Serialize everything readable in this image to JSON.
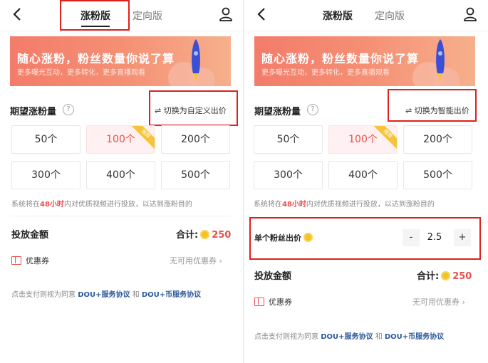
{
  "colors": {
    "accent": "#e94f4f",
    "highlight_box": "#e0201b",
    "coin": "#f5c228",
    "link": "#2e5a9c"
  },
  "left": {
    "tabs": [
      {
        "label": "涨粉版",
        "active": true
      },
      {
        "label": "定向版",
        "active": false
      }
    ],
    "banner": {
      "title": "随心涨粉，粉丝数量你说了算",
      "subtitle": "更多曝光互动，更多转化，更多直播观看"
    },
    "expect": {
      "label": "期望涨粉量",
      "help": "?",
      "switch_label": "⇌ 切换为自定义出价",
      "options": [
        "50个",
        "100个",
        "200个",
        "300个",
        "400个",
        "500个"
      ],
      "selected": "100个",
      "ribbon": "推荐"
    },
    "note": {
      "prefix": "系统将在",
      "highlight": "48小时",
      "suffix": "内对优质视频进行投放，以达到涨粉目的"
    },
    "amount": {
      "label": "投放金额",
      "total_label": "合计:",
      "total_value": "250"
    },
    "coupon": {
      "label": "优惠券",
      "value": "无可用优惠券 ›"
    },
    "agreement": {
      "prefix": "点击支付则视为同意",
      "link1": "DOU+服务协议",
      "and": "和",
      "link2": "DOU+币服务协议"
    }
  },
  "right": {
    "tabs": [
      {
        "label": "涨粉版",
        "active": true
      },
      {
        "label": "定向版",
        "active": false
      }
    ],
    "banner": {
      "title": "随心涨粉，粉丝数量你说了算",
      "subtitle": "更多曝光互动，更多转化，更多直播观看"
    },
    "expect": {
      "label": "期望涨粉量",
      "help": "?",
      "switch_label": "⇌ 切换为智能出价",
      "options": [
        "50个",
        "100个",
        "200个",
        "300个",
        "400个",
        "500个"
      ],
      "selected": "100个",
      "ribbon": "推荐"
    },
    "note": {
      "prefix": "系统将在",
      "highlight": "48小时",
      "suffix": "内对优质视频进行投放，以达到涨粉目的"
    },
    "unit_price": {
      "label": "单个粉丝出价",
      "minus": "-",
      "value": "2.5",
      "plus": "+"
    },
    "amount": {
      "label": "投放金额",
      "total_label": "合计:",
      "total_value": "250"
    },
    "coupon": {
      "label": "优惠券",
      "value": "无可用优惠券 ›"
    },
    "agreement": {
      "prefix": "点击支付则视为同意",
      "link1": "DOU+服务协议",
      "and": "和",
      "link2": "DOU+币服务协议"
    }
  }
}
